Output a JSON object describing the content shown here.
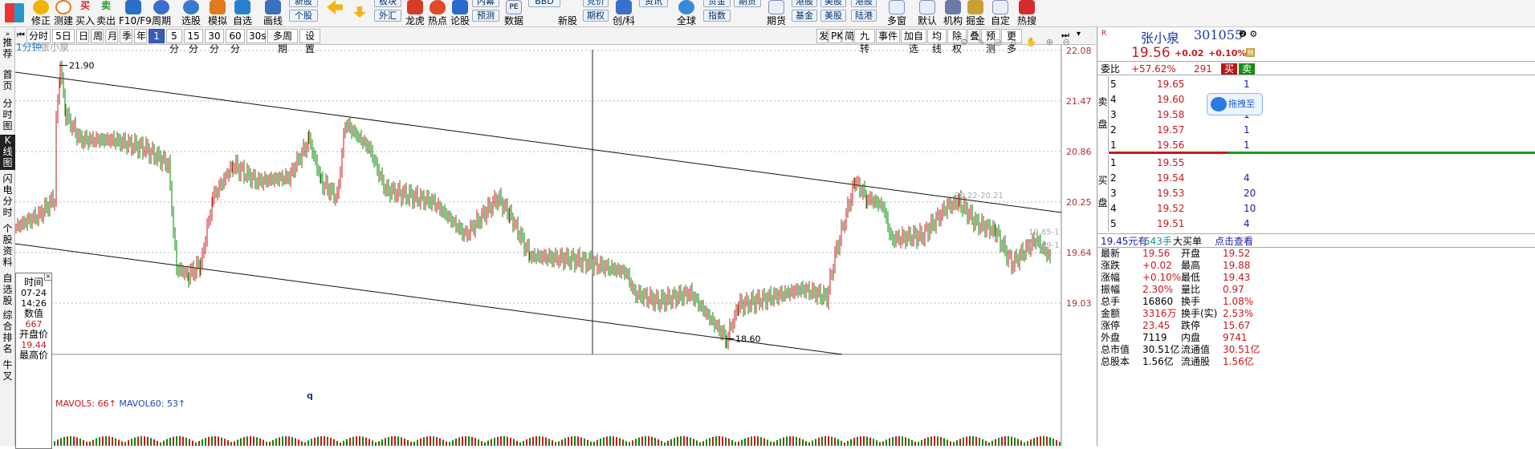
{
  "toolbar": {
    "items": [
      {
        "label": "修正",
        "color": "#f0b400"
      },
      {
        "label": "测建",
        "color": "#e8791e"
      },
      {
        "label": "买入",
        "color": "#d62a2a"
      },
      {
        "label": "卖出",
        "color": "#2a9a2a"
      },
      {
        "label": "F10/F9",
        "color": "#2a70c8"
      },
      {
        "label": "周期",
        "color": "#3d6dcc"
      },
      {
        "label": "选股",
        "color": "#3a7acc"
      },
      {
        "label": "模拟",
        "color": "#e07a1a"
      },
      {
        "label": "自选",
        "color": "#2a80d0"
      },
      {
        "label": "画线",
        "color": "#3a70c0"
      }
    ],
    "boxes": [
      {
        "top": "新股",
        "bottom": "个股"
      },
      {
        "top": "板块",
        "bottom": "外汇"
      },
      {
        "top": "内幕",
        "bottom": "预测"
      },
      {
        "top": "竞价",
        "bottom": "期权"
      },
      {
        "top": "资讯",
        "bottom": ""
      },
      {
        "top": "贵金",
        "bottom": "指数"
      },
      {
        "top": "港股",
        "bottom": "基金"
      },
      {
        "top": "美股",
        "bottom": "美股"
      },
      {
        "top": "港股",
        "bottom": "陆港"
      }
    ],
    "labels_mid": [
      "龙虎",
      "热点",
      "论股",
      "数据",
      "新股",
      "创/科",
      "全球"
    ],
    "labels_right": [
      "期货",
      "多窗",
      "默认",
      "机构",
      "掘金",
      "自定",
      "热搜"
    ],
    "box_inner": [
      "资讯",
      "期货",
      "BBD"
    ]
  },
  "left_tabs": [
    {
      "label": "推荐",
      "active": false
    },
    {
      "label": "首页",
      "active": false
    },
    {
      "label": "分时图",
      "active": false
    },
    {
      "label": "K线图",
      "active": true
    },
    {
      "label": "闪电分时",
      "active": false
    },
    {
      "label": "个股资料",
      "active": false
    },
    {
      "label": "自选股",
      "active": false
    },
    {
      "label": "综合排名",
      "active": false
    },
    {
      "label": "牛叉",
      "active": false
    }
  ],
  "timeframe": {
    "left": [
      "分时",
      "5日",
      "日",
      "周",
      "月",
      "季",
      "年",
      "1分",
      "5分",
      "15分",
      "30分",
      "60分",
      "30s",
      "多周期",
      "设置"
    ],
    "active": "1分",
    "right": [
      "发",
      "PK",
      "简",
      "九转",
      "事件",
      "加自选",
      "均线",
      "除权",
      "叠",
      "预测",
      "更多"
    ]
  },
  "chart": {
    "period_label": "1分钟",
    "stock_label": "张小泉",
    "y_ticks": [
      "22.08",
      "21.47",
      "20.86",
      "20.25",
      "19.64",
      "19.03"
    ],
    "high_label": "21.90",
    "low_label": "18.60",
    "mark_labels": [
      "20.22-20.21",
      "19.85-1",
      "19.69-1"
    ],
    "mavol": {
      "mavol5": "MAVOL5: 66↑",
      "mavol60": "MAVOL60: 53↑"
    },
    "cursor_letter": "q"
  },
  "tooltip": {
    "time_label": "时间",
    "date": "07-24",
    "time": "14:26",
    "value_label": "数值",
    "value": "667",
    "open_label": "开盘价",
    "open": "19.44",
    "high_label": "最高价"
  },
  "quote": {
    "name": "张小泉",
    "code": "301055",
    "price": "19.56",
    "change": "+0.02",
    "change_pct": "+0.10%",
    "weibi_label": "委比",
    "weibi": "+57.62%",
    "weicha": "291",
    "buy_btn": "买",
    "sell_btn": "卖",
    "sell_side_label": "卖盘",
    "buy_side_label": "买盘",
    "asks": [
      {
        "lvl": "5",
        "price": "19.65",
        "vol": "1"
      },
      {
        "lvl": "4",
        "price": "19.60",
        "vol": "1"
      },
      {
        "lvl": "3",
        "price": "19.58",
        "vol": "1"
      },
      {
        "lvl": "2",
        "price": "19.57",
        "vol": "1"
      },
      {
        "lvl": "1",
        "price": "19.56",
        "vol": "1"
      }
    ],
    "bids": [
      {
        "lvl": "1",
        "price": "19.55",
        "vol": ""
      },
      {
        "lvl": "2",
        "price": "19.54",
        "vol": "4"
      },
      {
        "lvl": "3",
        "price": "19.53",
        "vol": "20"
      },
      {
        "lvl": "4",
        "price": "19.52",
        "vol": "10"
      },
      {
        "lvl": "5",
        "price": "19.51",
        "vol": "4"
      }
    ],
    "summary_price": "19.45元有",
    "summary_vol": "543手",
    "summary_type": "大买单",
    "summary_link": "点击查看",
    "popup": "拖拽至",
    "stats": [
      {
        "l1": "最新",
        "v1": "19.56",
        "l2": "开盘",
        "v2": "19.52"
      },
      {
        "l1": "涨跌",
        "v1": "+0.02",
        "l2": "最高",
        "v2": "19.88"
      },
      {
        "l1": "涨幅",
        "v1": "+0.10%",
        "l2": "最低",
        "v2": "19.43"
      },
      {
        "l1": "振幅",
        "v1": "2.30%",
        "l2": "量比",
        "v2": "0.97"
      },
      {
        "l1": "总手",
        "v1": "16860",
        "l2": "换手",
        "v2": "1.08%"
      },
      {
        "l1": "金额",
        "v1": "3316万",
        "l2": "换手(实)",
        "v2": "2.53%"
      },
      {
        "l1": "涨停",
        "v1": "23.45",
        "l2": "跌停",
        "v2": "15.67"
      },
      {
        "l1": "外盘",
        "v1": "7119",
        "l2": "内盘",
        "v2": "9741"
      },
      {
        "l1": "总市值",
        "v1": "30.51亿",
        "l2": "流通值",
        "v2": "30.51亿"
      },
      {
        "l1": "总股本",
        "v1": "1.56亿",
        "l2": "流通股",
        "v2": "1.56亿"
      }
    ]
  },
  "colors": {
    "up": "#c8191e",
    "down": "#008a00",
    "grid": "#b8b8b8"
  }
}
